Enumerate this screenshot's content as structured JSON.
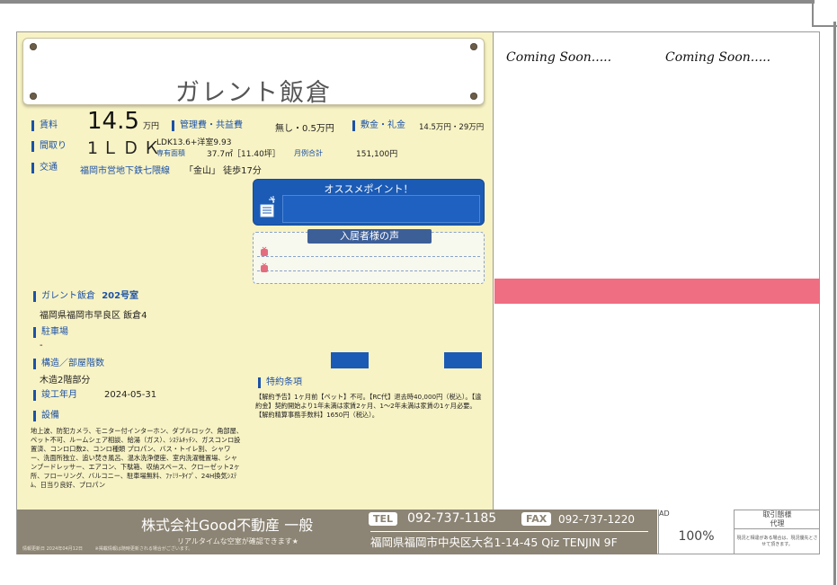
{
  "property": {
    "name": "ガレント飯倉",
    "room_line_name": "ガレント飯倉",
    "room_number": "202号室",
    "address": "福岡県福岡市早良区 飯倉4"
  },
  "rent": {
    "label": "賃料",
    "value": "14.5",
    "unit": "万円",
    "fee_label": "管理費・共益費",
    "fee_value": "無し・0.5万円",
    "deposit_label": "敷金・礼金",
    "deposit_value": "14.5万円・29万円"
  },
  "layout": {
    "label": "間取り",
    "value": "1ＬＤＫ",
    "detail": "LDK13.6+洋室9.93",
    "area_label": "専有面積",
    "area_value": "37.7㎡［11.40坪］",
    "monthly_label": "月例合計",
    "monthly_value": "151,100円"
  },
  "access": {
    "label": "交通",
    "line": "福岡市営地下鉄七隈線",
    "station": "「金山」 徒歩17分"
  },
  "recommend": {
    "title": "オススメポイント！"
  },
  "voice": {
    "title": "入居者様の声"
  },
  "parking": {
    "label": "駐車場",
    "value": "-"
  },
  "structure": {
    "label": "構造／部屋階数",
    "value": "木造2階部分"
  },
  "completion": {
    "label": "竣工年月",
    "value": "2024-05-31"
  },
  "facilities": {
    "label": "設備",
    "text": "地上波、防犯カメラ、モニター付インターホン、ダブルロック、角部屋、ペット不可、ルームシェア相談、給湯（ガス）、ｼｽﾃﾑｷｯﾁﾝ、ガスコンロ設置済、コンロ口数2、コンロ種類 プロパン、バス・トイレ別、シャワー、洗面所独立、追い焚き風呂、温水洗浄便座、室内洗濯機置場、シャンプードレッサー、エアコン、下駄箱、収納スペース、クローゼット2ヶ所、フローリング、バルコニー、駐車場無料、ﾌｧﾐﾘｰﾀｲﾌﾟ、24H換気ｼｽﾃﾑ、日当り良好、プロパン"
  },
  "special": {
    "label": "特約条項",
    "text": "【解約予告】1ヶ月前【ペット】不可。【RC代】退去時40,000円（税込）。【違約金】契約開始より1年未満は家賃2ヶ月、1～2年未満は家賃の1ヶ月必要。【解約精算事務手数料】1650円（税込）。"
  },
  "photos": {
    "coming_1": "Coming Soon.....",
    "coming_2": "Coming Soon....."
  },
  "footer": {
    "company": "株式会社Good不動産 一般",
    "tagline": "リアルタイムな空室が確認できます★",
    "tel_label": "TEL",
    "tel": "092-737-1185",
    "fax_label": "FAX",
    "fax": "092-737-1220",
    "address": "福岡県福岡市中央区大名1-14-45 Qiz TENJIN 9F",
    "note_left": "情報更新日 2024年04月12日",
    "note_mid": "※掲載情報は随時更新される場合がございます。"
  },
  "ad": {
    "label": "AD",
    "value": "100%"
  },
  "agent": {
    "title_line1": "取引態様",
    "title_line2": "代理",
    "note": "現況と相違がある場合は、現況優先とさせて頂きます。"
  },
  "colors": {
    "accent_blue": "#1c52a8",
    "panel_yellow": "#f8f3c4",
    "pink_bar": "#ef6e82",
    "footer_gray": "#8c8474"
  }
}
